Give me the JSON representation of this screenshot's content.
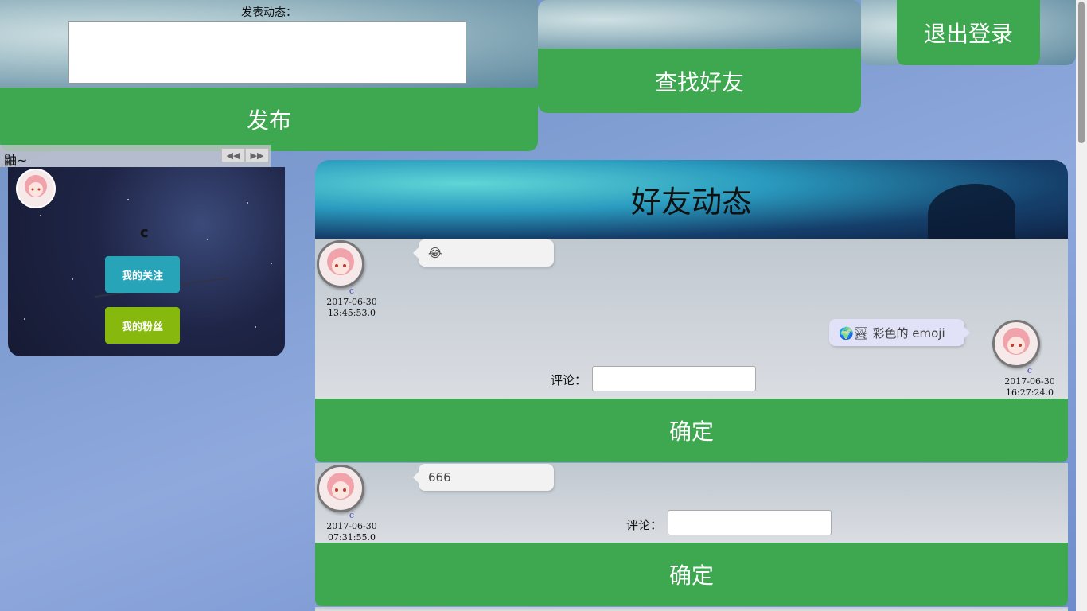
{
  "post_form": {
    "label": "发表动态：",
    "textarea_value": "",
    "publish_label": "发布"
  },
  "search": {
    "placeholder": "",
    "button_label": "查找好友"
  },
  "logout": {
    "label": "退出登录"
  },
  "music": {
    "title": "鼬~",
    "prev_icon": "◀◀",
    "next_icon": "▶▶"
  },
  "profile": {
    "name": "c",
    "following_label": "我的关注",
    "fans_label": "我的粉丝"
  },
  "feed": {
    "title": "好友动态",
    "posts": [
      {
        "author": "c",
        "date": "2017-06-30",
        "time": "13:45:53.0",
        "content": "😂",
        "reply": {
          "author": "c",
          "date": "2017-06-30",
          "time": "16:27:24.0",
          "content": "🌍🏞 彩色的 emoji"
        },
        "comment_label": "评论：",
        "confirm_label": "确定"
      },
      {
        "author": "c",
        "date": "2017-06-30",
        "time": "07:31:55.0",
        "content": "666",
        "comment_label": "评论：",
        "confirm_label": "确定"
      }
    ]
  },
  "colors": {
    "green": "#3ea851",
    "teal": "#27a4b7",
    "lime": "#86b80e",
    "author_blue": "#4a3fc0"
  }
}
